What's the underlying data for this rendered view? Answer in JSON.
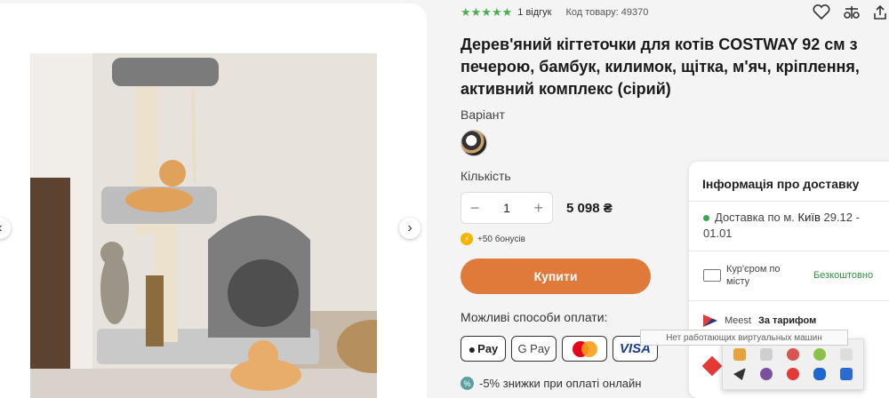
{
  "gallery": {
    "prev_arrow": "‹",
    "next_arrow": "›",
    "photo_alt": "COSTWAY cat tree"
  },
  "product": {
    "rating": {
      "stars": "★★★★★",
      "value": 5,
      "reviews": "1 відгук"
    },
    "code": "Код товару: 49370",
    "title": "Дерев'яний кігтеточки для котів COSTWAY 92 см з печерою, бамбук, килимок, щітка, м'яч, кріплення, активний комплекс (сірий)",
    "variant_label": "Варіант",
    "quantity_label": "Кількість",
    "quantity": {
      "minus": "−",
      "value": "1",
      "plus": "+"
    },
    "price": "5 098 ₴",
    "bonus": "+50 бонусів",
    "buy_button": "Купити",
    "payment_label": "Можливі способи оплати:",
    "payment_methods": [
      {
        "name": "Apple Pay",
        "text": "Pay",
        "icon": "apple-icon"
      },
      {
        "name": "Google Pay",
        "text": "G Pay"
      },
      {
        "name": "Mastercard",
        "icon": "mastercard-icon"
      },
      {
        "name": "Visa",
        "text": "VISA"
      }
    ],
    "discount_text": "-5% знижки при оплаті онлайн"
  },
  "delivery": {
    "title": "Інформація про доставку",
    "city_prefix": "Доставка по м.",
    "city": "Київ",
    "dates": "29.12 - 01.01",
    "courier_label": "Кур'єром по місту",
    "courier_price": "Безкоштовно",
    "meest_name": "Meest",
    "meest_price": "За тарифом"
  },
  "tray": {
    "tooltip": "Нет работающих виртуальных машин"
  },
  "colors": {
    "accent_orange": "#e07a3a",
    "star_green": "#4cae4f",
    "free_green": "#2f8f3f",
    "bonus_yellow": "#f5b400"
  }
}
